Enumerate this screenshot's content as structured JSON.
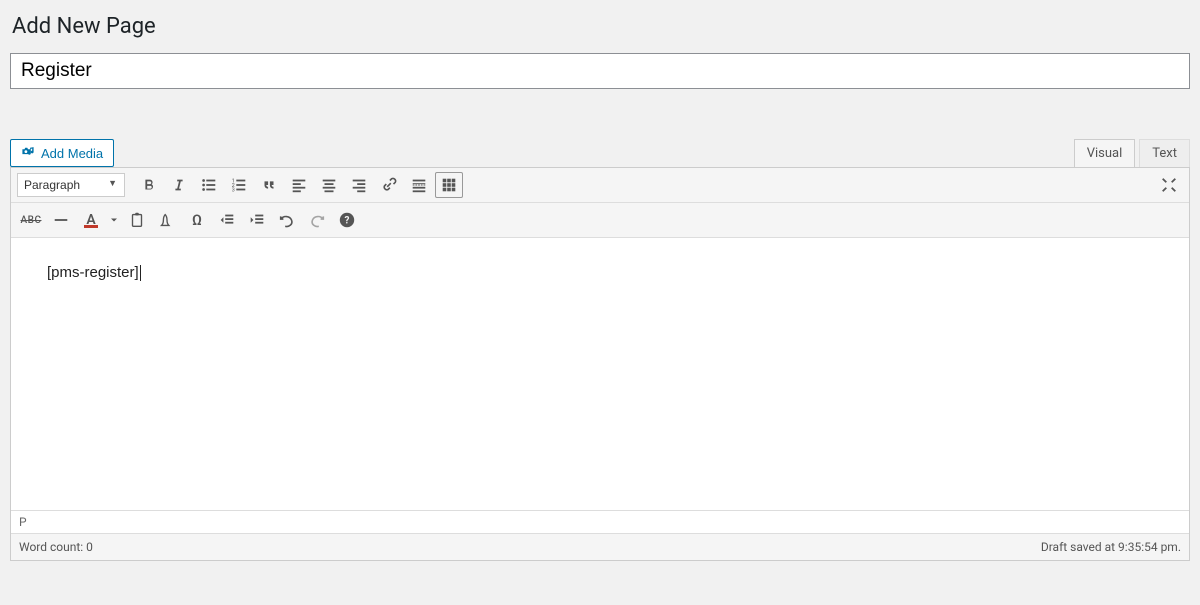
{
  "header": {
    "page_title": "Add New Page"
  },
  "title_field": {
    "value": "Register"
  },
  "media": {
    "add_media_label": "Add Media"
  },
  "editor_tabs": {
    "visual": "Visual",
    "text": "Text"
  },
  "toolbar": {
    "format_select": "Paragraph"
  },
  "editor": {
    "content": "[pms-register]",
    "path": "P"
  },
  "statusbar": {
    "wordcount_label": "Word count: 0",
    "saved_label": "Draft saved at 9:35:54 pm."
  },
  "icons": {
    "camera_music": "camera-music-icon",
    "bold": "bold-icon",
    "italic": "italic-icon",
    "ul": "unordered-list-icon",
    "ol": "ordered-list-icon",
    "quote": "quote-icon",
    "align_left": "align-left-icon",
    "align_center": "align-center-icon",
    "align_right": "align-right-icon",
    "link": "link-icon",
    "readmore": "read-more-icon",
    "toolbar_toggle": "toolbar-toggle-icon",
    "fullscreen": "fullscreen-icon",
    "strike": "strikethrough-icon",
    "hr": "horizontal-rule-icon",
    "text_color": "text-color-icon",
    "color_dropdown": "color-dropdown-icon",
    "paste_clipboard": "paste-clipboard-icon",
    "clear": "clear-formatting-icon",
    "special": "special-char-icon",
    "outdent": "outdent-icon",
    "indent": "indent-icon",
    "undo": "undo-icon",
    "redo": "redo-icon",
    "help": "help-icon"
  }
}
